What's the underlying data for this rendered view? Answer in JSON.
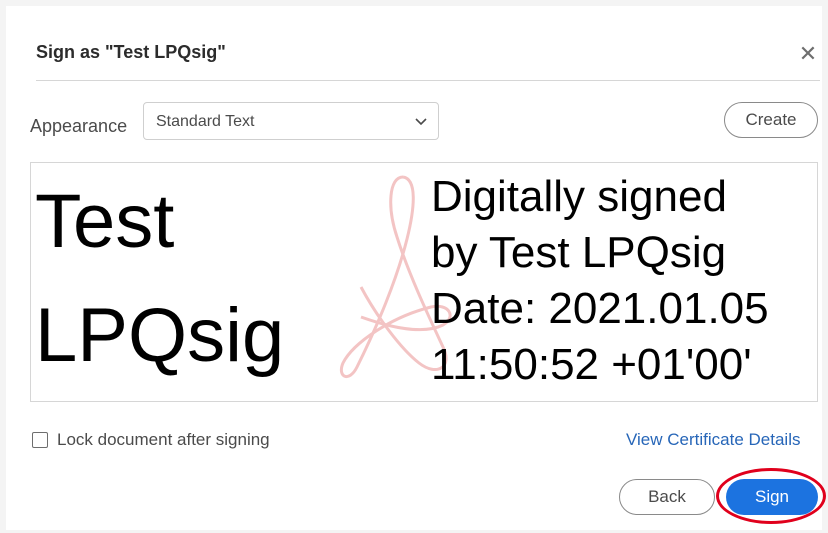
{
  "dialog": {
    "title": "Sign as \"Test LPQsig\"",
    "close_icon": "close-icon"
  },
  "appearance": {
    "label": "Appearance",
    "selected": "Standard Text",
    "chevron_icon": "chevron-down-icon",
    "create_label": "Create"
  },
  "preview": {
    "name_text": "Test\nLPQsig",
    "details_text": "Digitally signed\nby Test LPQsig\nDate: 2021.01.05\n11:50:52 +01'00'",
    "watermark_icon": "acrobat-logo-icon"
  },
  "options": {
    "lock_label": "Lock document after signing",
    "lock_checked": false,
    "cert_link": "View Certificate Details"
  },
  "actions": {
    "back_label": "Back",
    "sign_label": "Sign",
    "highlight_color": "#e0001c",
    "primary_color": "#1c73e0"
  }
}
